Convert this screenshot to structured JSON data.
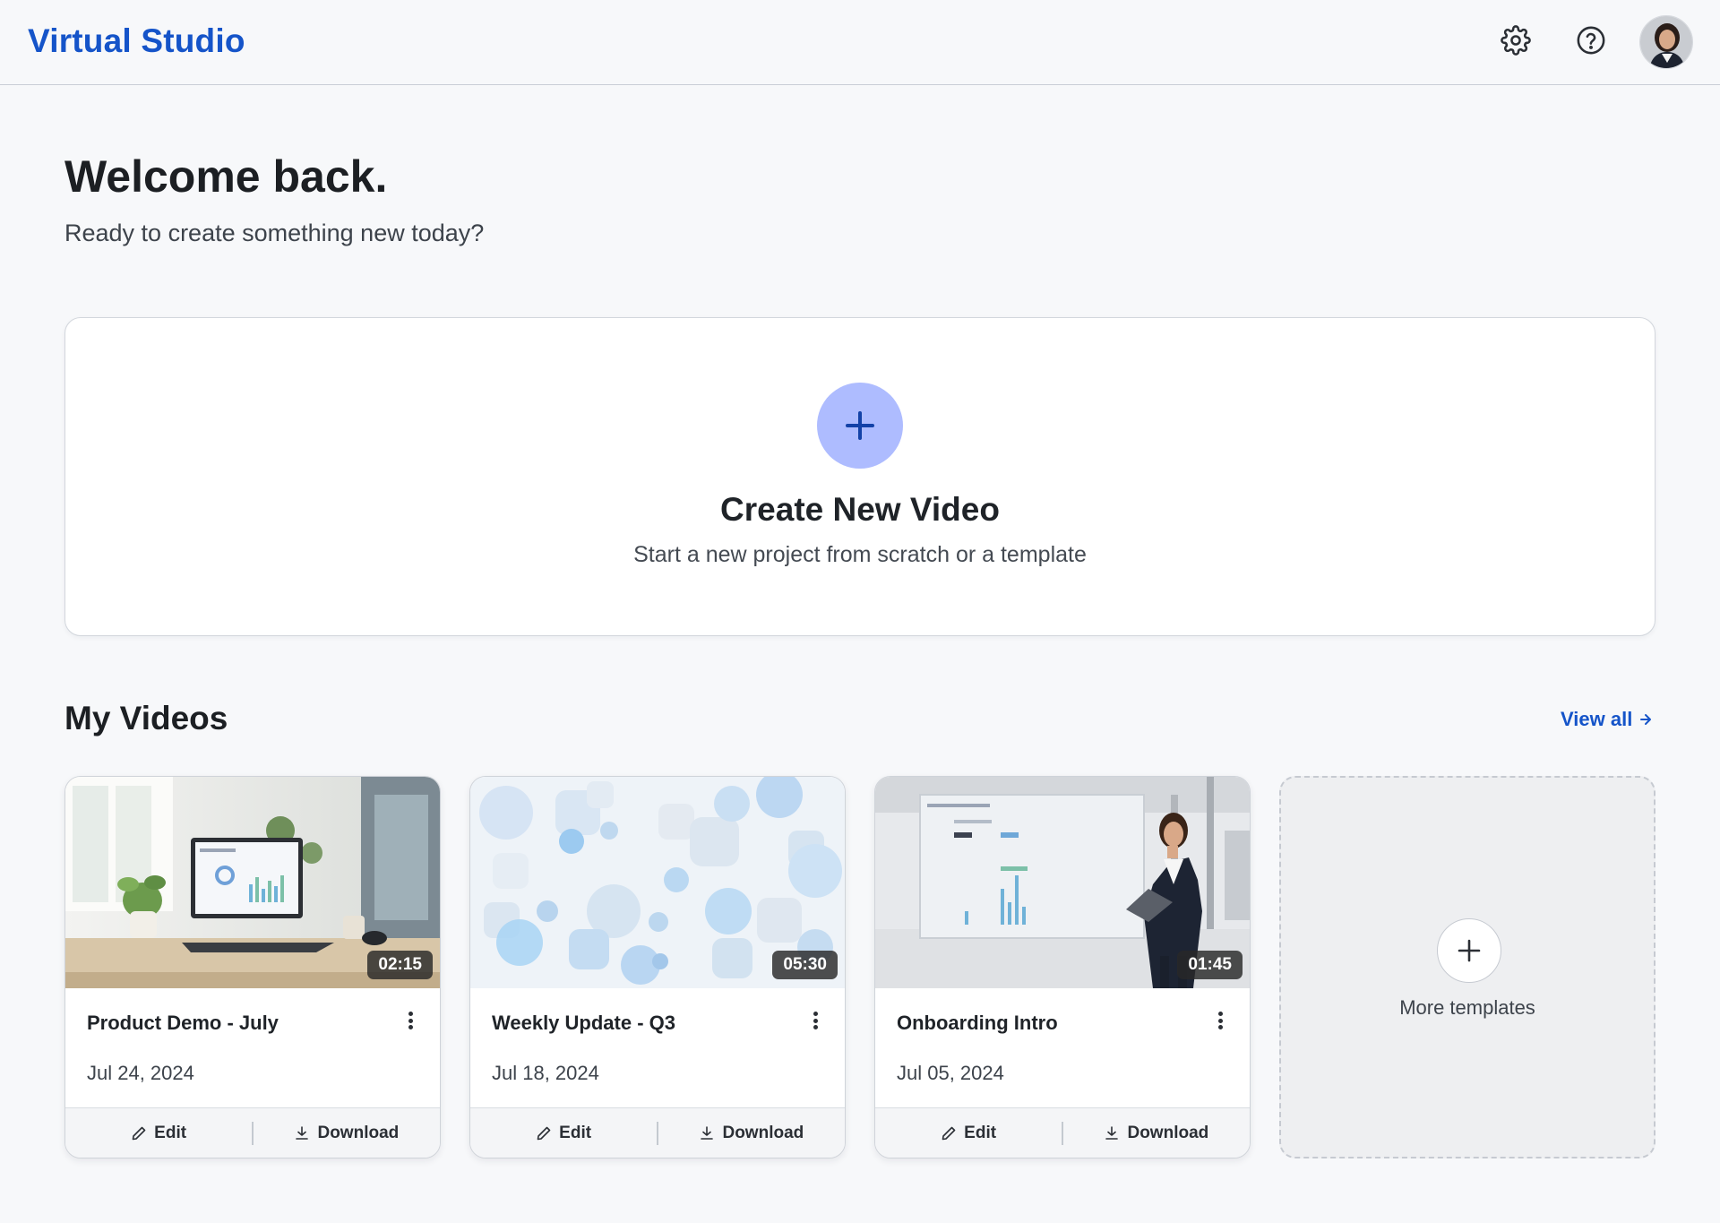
{
  "header": {
    "brand": "Virtual Studio",
    "settings_icon": "gear-icon",
    "help_icon": "question-circle-icon",
    "avatar_icon": "user-avatar"
  },
  "welcome": {
    "title": "Welcome back.",
    "subtitle": "Ready to create something new today?"
  },
  "create": {
    "title": "Create New Video",
    "subtitle": "Start a new project from scratch or a template",
    "icon": "plus-icon"
  },
  "videos": {
    "section_title": "My Videos",
    "view_all_label": "View all",
    "items": [
      {
        "title": "Product Demo - July",
        "date": "Jul 24, 2024",
        "duration": "02:15",
        "edit_label": "Edit",
        "download_label": "Download"
      },
      {
        "title": "Weekly Update - Q3",
        "date": "Jul 18, 2024",
        "duration": "05:30",
        "edit_label": "Edit",
        "download_label": "Download"
      },
      {
        "title": "Onboarding Intro",
        "date": "Jul 05, 2024",
        "duration": "01:45",
        "edit_label": "Edit",
        "download_label": "Download"
      }
    ],
    "more_label": "More templates"
  },
  "colors": {
    "accent": "#1554c9",
    "create_plus_bg": "#aebcff",
    "background": "#f7f8fa"
  }
}
